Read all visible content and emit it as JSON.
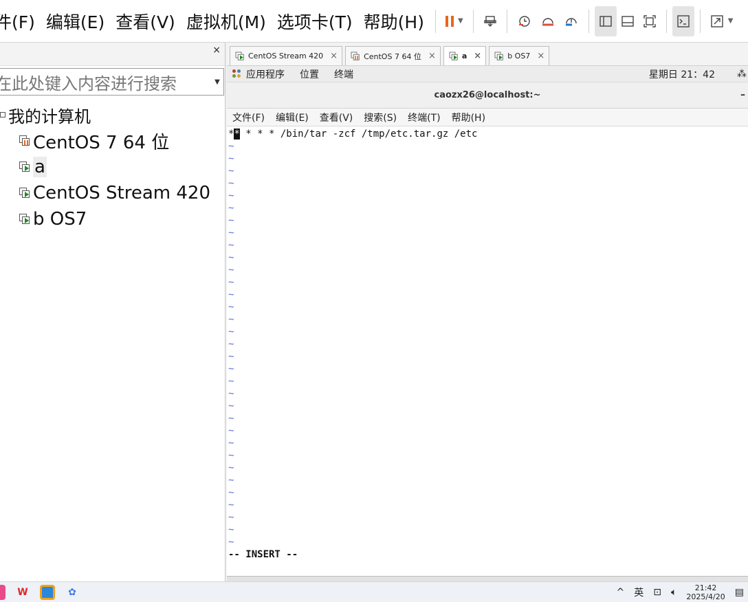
{
  "menubar": {
    "items": [
      "件(F)",
      "编辑(E)",
      "查看(V)",
      "虚拟机(M)",
      "选项卡(T)",
      "帮助(H)"
    ]
  },
  "toolbar": {
    "icons": [
      "pause-icon",
      "send-ctrl-alt-del-icon",
      "snapshot-icon",
      "revert-snapshot-icon",
      "snapshot-manager-icon",
      "library-view-icon",
      "thumbnail-view-icon",
      "fullscreen-icon",
      "console-view-icon",
      "stretch-icon"
    ],
    "colors": {
      "pause": "#e8661c",
      "snapshot_red": "#d94f3a",
      "snapshot_blue": "#1f73c9"
    }
  },
  "library": {
    "close_label": "×",
    "search_placeholder": "在此处键入内容进行搜索",
    "root_label": "我的计算机",
    "items": [
      {
        "label": "CentOS 7 64 位",
        "state": "paused"
      },
      {
        "label": "a",
        "state": "running",
        "selected": true
      },
      {
        "label": "CentOS Stream 420",
        "state": "running"
      },
      {
        "label": "b OS7",
        "state": "running"
      }
    ]
  },
  "tabs": [
    {
      "label": "CentOS Stream 420",
      "state": "running",
      "active": false
    },
    {
      "label": "CentOS 7 64 位",
      "state": "paused",
      "active": false
    },
    {
      "label": "a",
      "state": "running",
      "active": true
    },
    {
      "label": "b OS7",
      "state": "running",
      "active": false
    }
  ],
  "gnome_bar": {
    "apps": "应用程序",
    "places": "位置",
    "terminal": "终端",
    "clock": "星期日 21：42"
  },
  "terminal": {
    "title": "caozx26@localhost:~",
    "minimize": "–",
    "menu": [
      "文件(F)",
      "编辑(E)",
      "查看(V)",
      "搜索(S)",
      "终端(T)",
      "帮助(H)"
    ],
    "first_char": "*",
    "cursor_char": "*",
    "rest_of_line": " * * * /bin/tar -zcf /tmp/etc.tar.gz /etc",
    "tilde": "~",
    "mode": "-- INSERT --"
  },
  "taskbar": {
    "ime": "英",
    "time": "21:42",
    "date": "2025/4/20",
    "colors": {
      "wps": "#e0282e",
      "app2_a": "#f3a21b",
      "app2_b": "#2b87d9",
      "app3": "#3b7be8"
    }
  }
}
